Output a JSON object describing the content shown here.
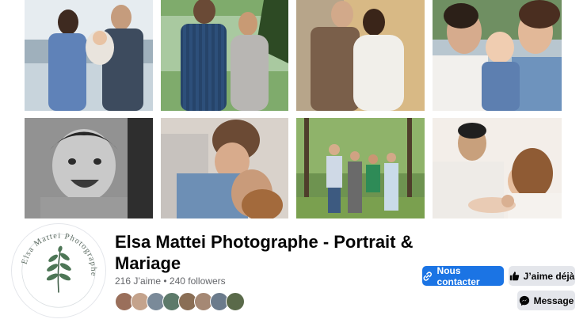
{
  "page": {
    "name": "Elsa Mattei Photographe - Portrait & Mariage",
    "likes": "216 J’aime",
    "separator": " • ",
    "followers": "240 followers"
  },
  "logo_text": "Elsa Mattei Photographe",
  "actions": {
    "contact_label": "Nous contacter",
    "like_label": "J’aime déjà",
    "message_label": "Message"
  },
  "cover_photos": [
    {
      "desc": "couple-with-baby-lake",
      "bg": "#b9c6cf"
    },
    {
      "desc": "pregnant-couple-lake",
      "bg": "#8fb67a"
    },
    {
      "desc": "couple-wedding-autumn",
      "bg": "#d9c7a3"
    },
    {
      "desc": "family-kissing-baby",
      "bg": "#c9d2da"
    },
    {
      "desc": "boy-laughing-bw",
      "bg": "#8c8c8c"
    },
    {
      "desc": "couple-embrace",
      "bg": "#b9aea3"
    },
    {
      "desc": "family-forest",
      "bg": "#6f8f4e"
    },
    {
      "desc": "newborn-parents",
      "bg": "#efe9e3"
    }
  ],
  "friend_avatar_colors": [
    "#9a6f5b",
    "#c4a38c",
    "#7a8a99",
    "#5d7a6a",
    "#8a6e55",
    "#a58874",
    "#6b7b8c",
    "#5a6a4a"
  ]
}
